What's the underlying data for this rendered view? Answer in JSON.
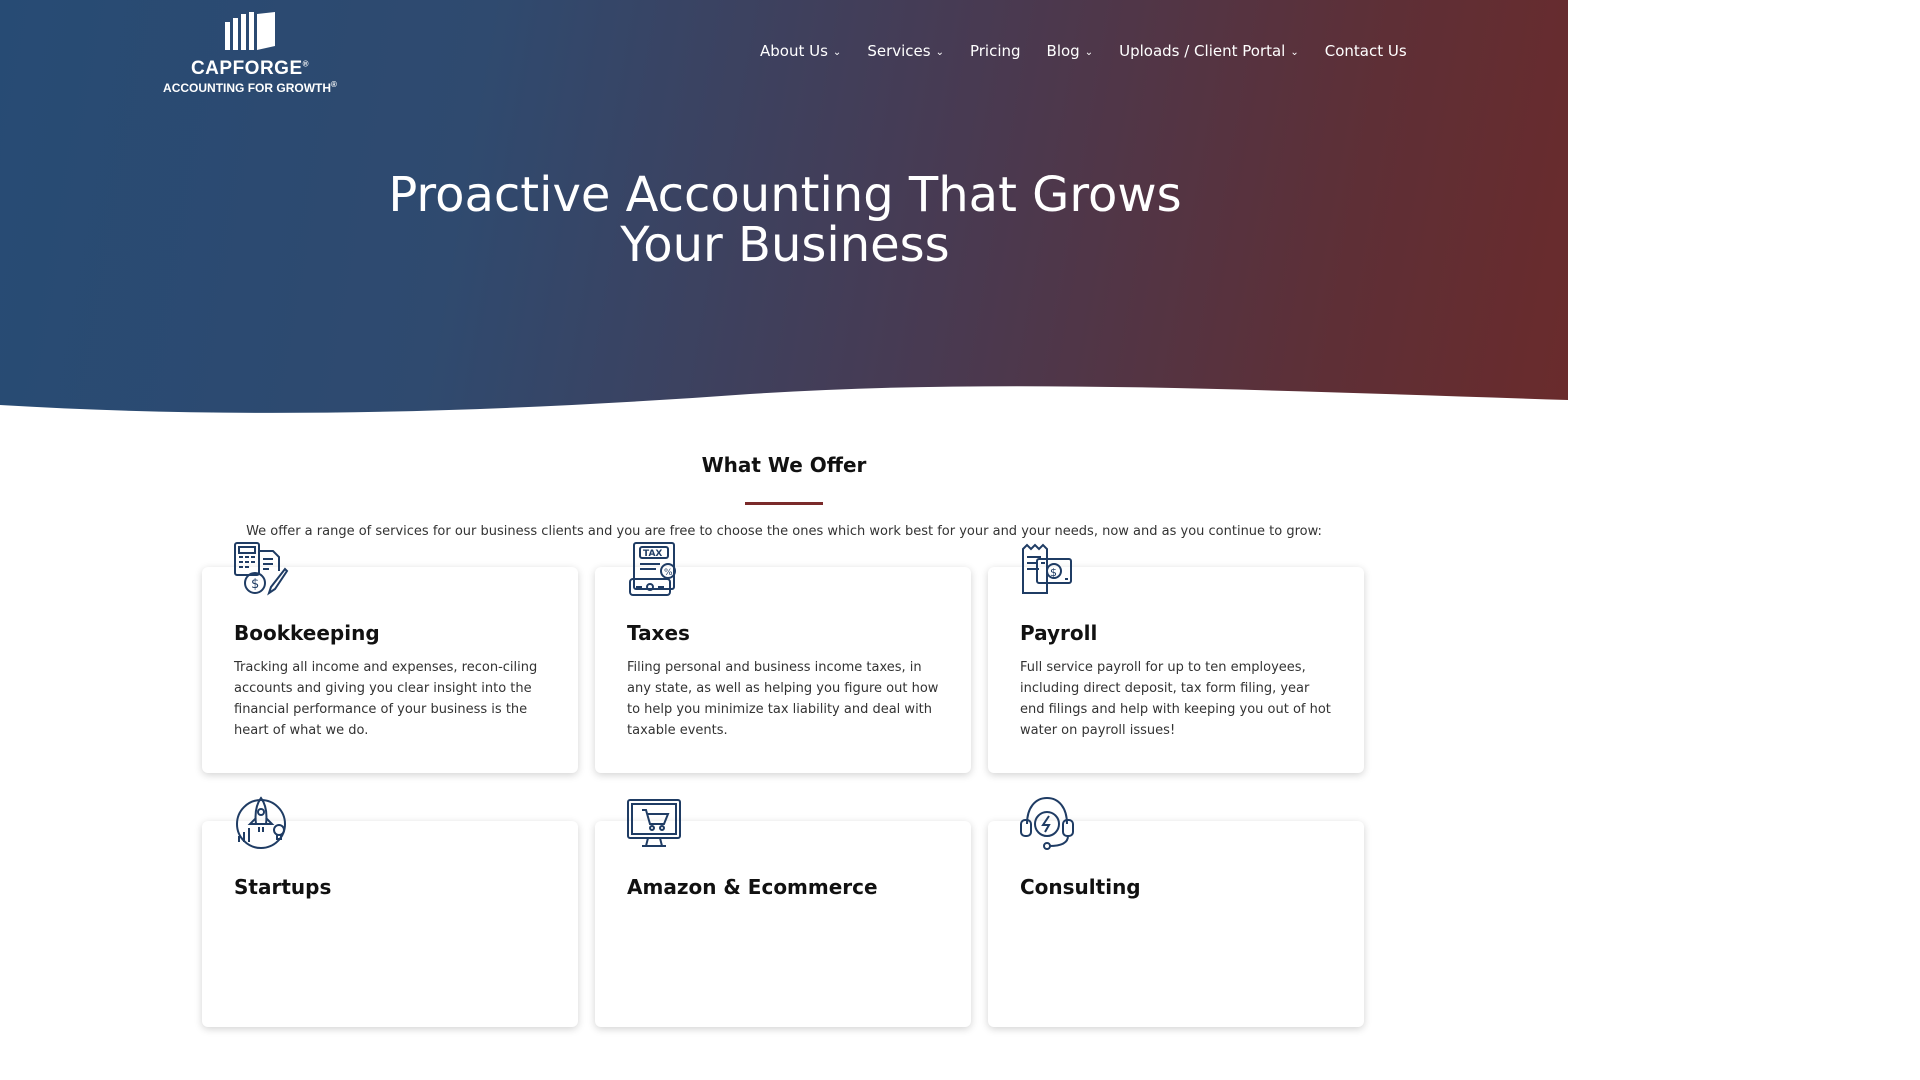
{
  "brand": {
    "name": "CAPFORGE",
    "tagline": "ACCOUNTING FOR GROWTH",
    "reg": "®"
  },
  "nav": [
    {
      "label": "About Us",
      "dropdown": true
    },
    {
      "label": "Services",
      "dropdown": true
    },
    {
      "label": "Pricing",
      "dropdown": false
    },
    {
      "label": "Blog",
      "dropdown": true
    },
    {
      "label": "Uploads / Client Portal",
      "dropdown": true
    },
    {
      "label": "Contact Us",
      "dropdown": false
    }
  ],
  "hero": {
    "title_line1": "Proactive Accounting That Grows",
    "title_line2": "Your Business"
  },
  "offer": {
    "title": "What We Offer",
    "intro": "We offer a range of services for our business clients and you are free to choose the ones which work best for your and your needs, now and as you continue to grow:"
  },
  "services": [
    {
      "title": "Bookkeeping",
      "icon": "bookkeeping-icon",
      "text": "Tracking all income and expenses, recon-ciling accounts and giving you clear insight into the financial performance of your business is the heart of what we do."
    },
    {
      "title": "Taxes",
      "icon": "tax-icon",
      "text": "Filing personal and business income taxes, in any state, as well as helping you figure out how to help you minimize tax liability and deal with taxable events."
    },
    {
      "title": "Payroll",
      "icon": "payroll-icon",
      "text": "Full service payroll for up to ten employees, including direct deposit, tax form filing, year end filings and help with keeping you out of hot water on payroll issues!"
    },
    {
      "title": "Startups",
      "icon": "rocket-icon",
      "text": ""
    },
    {
      "title": "Amazon & Ecommerce",
      "icon": "shopping-cart-icon",
      "text": ""
    },
    {
      "title": "Consulting",
      "icon": "headset-icon",
      "text": ""
    }
  ],
  "colors": {
    "hero_left": "#274b74",
    "hero_right": "#6a2b2c",
    "accent_rule": "#7a2a2a",
    "icon_navy": "#1f3c64"
  }
}
